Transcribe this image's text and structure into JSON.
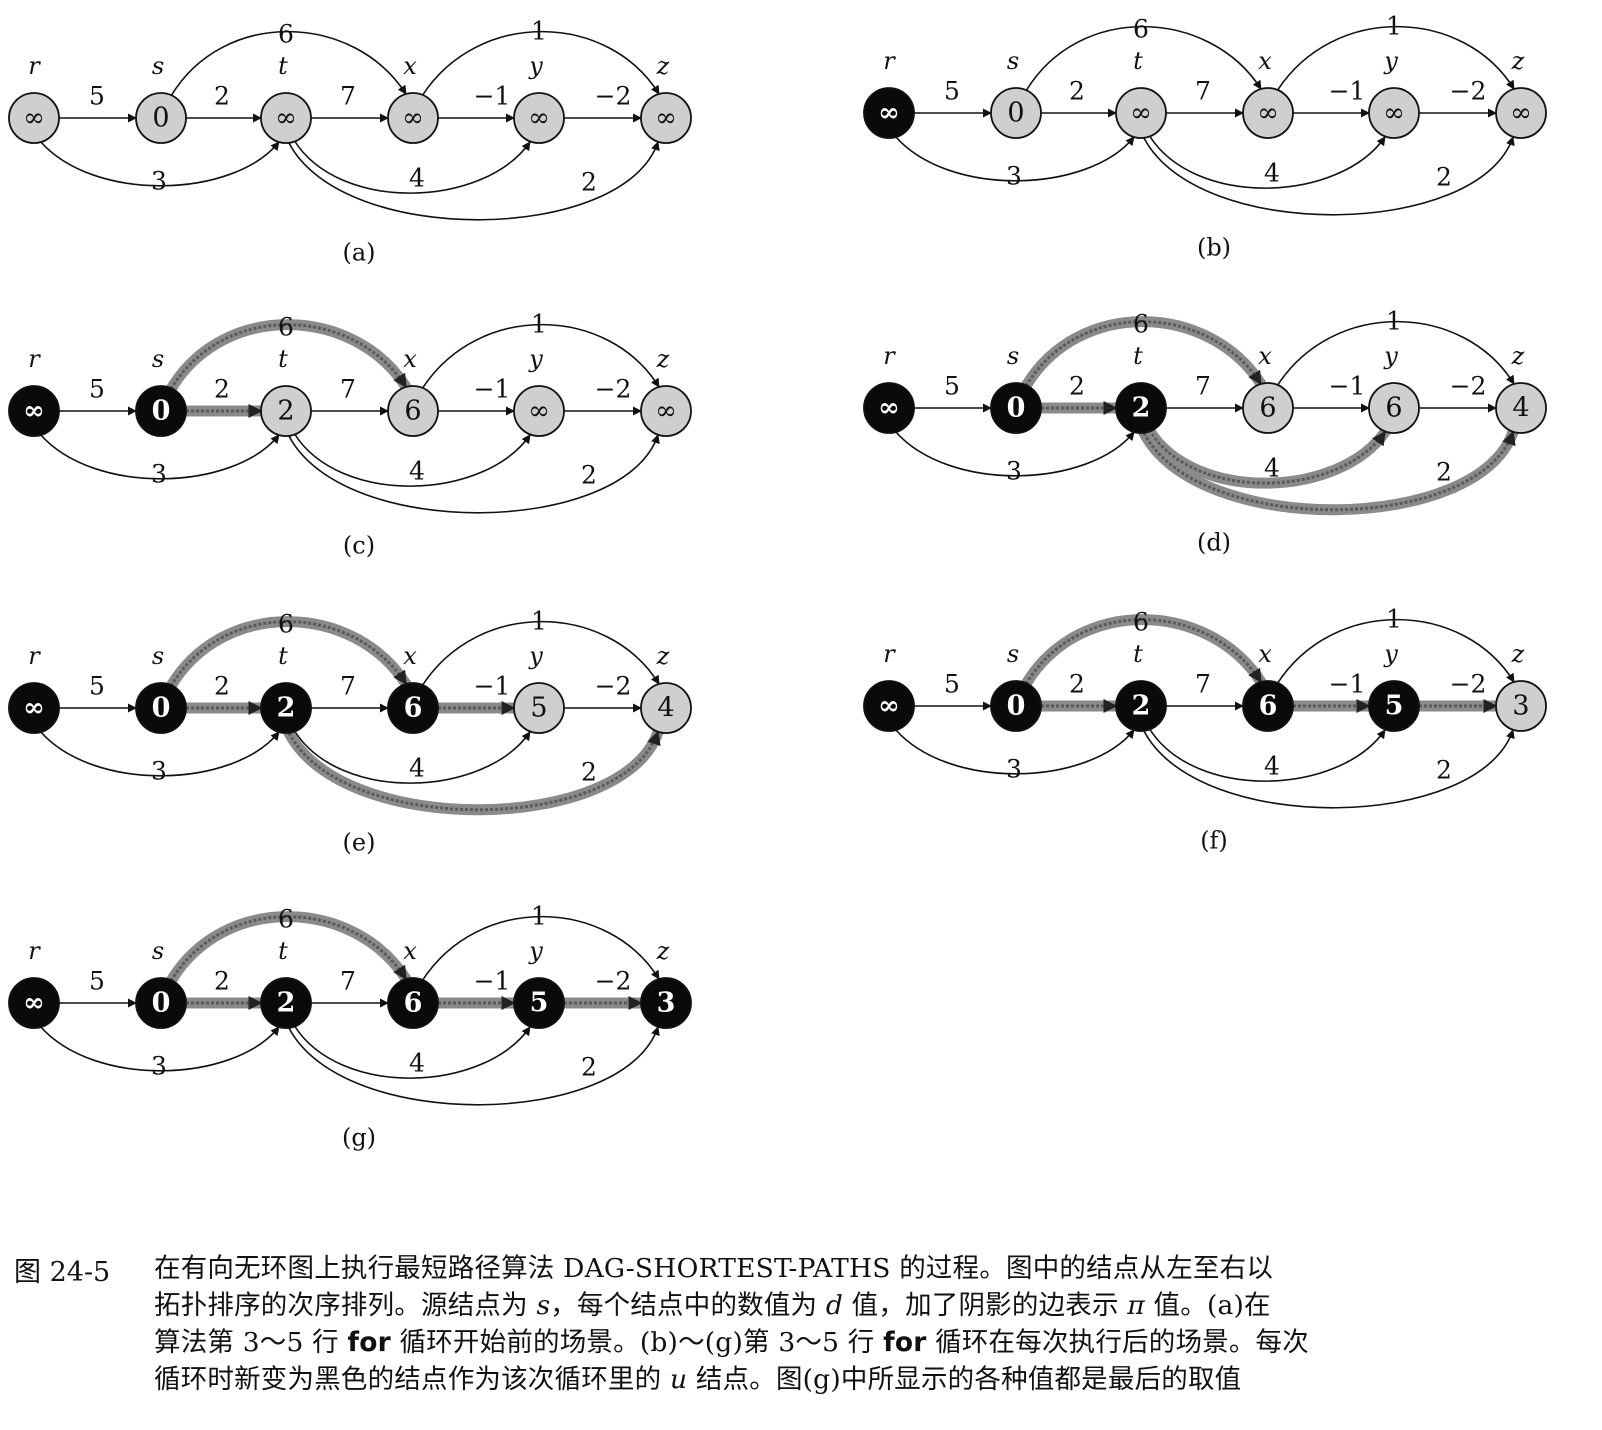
{
  "nodes": [
    "r",
    "s",
    "t",
    "x",
    "y",
    "z"
  ],
  "edges": [
    {
      "from": "r",
      "to": "s",
      "w": "5"
    },
    {
      "from": "r",
      "to": "t",
      "w": "3"
    },
    {
      "from": "s",
      "to": "t",
      "w": "2"
    },
    {
      "from": "s",
      "to": "x",
      "w": "6"
    },
    {
      "from": "t",
      "to": "x",
      "w": "7"
    },
    {
      "from": "t",
      "to": "y",
      "w": "4"
    },
    {
      "from": "t",
      "to": "z",
      "w": "2"
    },
    {
      "from": "x",
      "to": "y",
      "w": "−1"
    },
    {
      "from": "x",
      "to": "z",
      "w": "1"
    },
    {
      "from": "y",
      "to": "z",
      "w": "−2"
    }
  ],
  "panels": [
    {
      "label": "(a)",
      "d": [
        "∞",
        "0",
        "∞",
        "∞",
        "∞",
        "∞"
      ],
      "black": [],
      "shaded": []
    },
    {
      "label": "(b)",
      "d": [
        "∞",
        "0",
        "∞",
        "∞",
        "∞",
        "∞"
      ],
      "black": [
        "r"
      ],
      "shaded": []
    },
    {
      "label": "(c)",
      "d": [
        "∞",
        "0",
        "2",
        "6",
        "∞",
        "∞"
      ],
      "black": [
        "r",
        "s"
      ],
      "shaded": [
        "s-t",
        "s-x"
      ]
    },
    {
      "label": "(d)",
      "d": [
        "∞",
        "0",
        "2",
        "6",
        "6",
        "4"
      ],
      "black": [
        "r",
        "s",
        "t"
      ],
      "shaded": [
        "s-t",
        "s-x",
        "t-y",
        "t-z"
      ]
    },
    {
      "label": "(e)",
      "d": [
        "∞",
        "0",
        "2",
        "6",
        "5",
        "4"
      ],
      "black": [
        "r",
        "s",
        "t",
        "x"
      ],
      "shaded": [
        "s-t",
        "s-x",
        "x-y",
        "t-z"
      ]
    },
    {
      "label": "(f)",
      "d": [
        "∞",
        "0",
        "2",
        "6",
        "5",
        "3"
      ],
      "black": [
        "r",
        "s",
        "t",
        "x",
        "y"
      ],
      "shaded": [
        "s-t",
        "s-x",
        "x-y",
        "y-z"
      ]
    },
    {
      "label": "(g)",
      "d": [
        "∞",
        "0",
        "2",
        "6",
        "5",
        "3"
      ],
      "black": [
        "r",
        "s",
        "t",
        "x",
        "y",
        "z"
      ],
      "shaded": [
        "s-t",
        "s-x",
        "x-y",
        "y-z"
      ]
    }
  ],
  "caption": {
    "number": "图 24-5",
    "line1": "在有向无环图上执行最短路径算法 DAG-SHORTEST-PATHS 的过程。图中的结点从左至右以",
    "line2a": "拓扑排序的次序排列。源结点为 ",
    "line2_s": "s",
    "line2b": "，每个结点中的数值为 ",
    "line2_d": "d",
    "line2c": " 值，加了阴影的边表示 ",
    "line2_pi": "π",
    "line2d": " 值。(a)在",
    "line3a": "算法第 3～5 行 ",
    "line3_for": "for",
    "line3b": " 循环开始前的场景。(b)～(g)第 3～5 行 ",
    "line3_for2": "for",
    "line3c": " 循环在每次执行后的场景。每次",
    "line4a": "循环时新变为黑色的结点作为该次循环里的 ",
    "line4_u": "u",
    "line4b": " 结点。图(g)中所显示的各种值都是最后的取值"
  }
}
